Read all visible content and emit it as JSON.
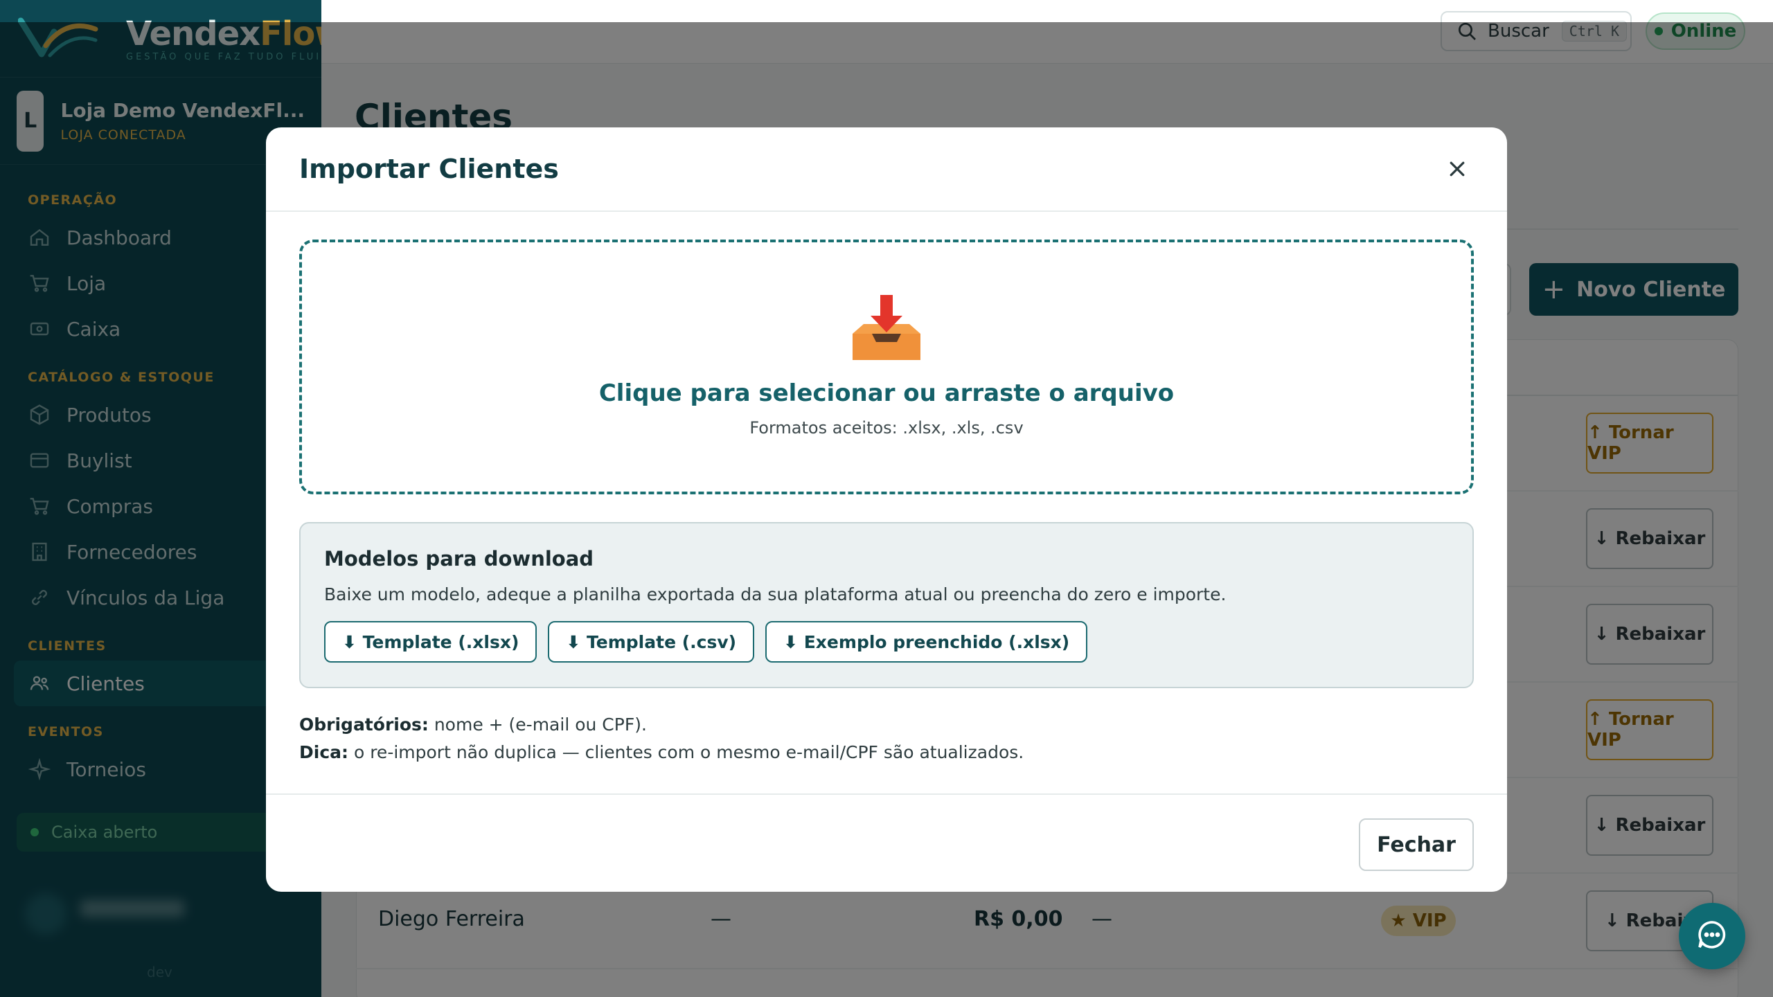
{
  "brand": {
    "name_part1": "Vendex",
    "name_part2": "Flow",
    "tagline": "GESTÃO QUE FAZ TUDO FLUIR"
  },
  "store": {
    "avatar_letter": "L",
    "name": "Loja Demo VendexFl...",
    "status": "LOJA CONECTADA"
  },
  "sidebar": {
    "sections": [
      {
        "title": "OPERAÇÃO",
        "items": [
          {
            "label": "Dashboard",
            "icon": "home-icon"
          },
          {
            "label": "Loja",
            "icon": "cart-icon"
          },
          {
            "label": "Caixa",
            "icon": "cash-icon"
          }
        ]
      },
      {
        "title": "CATÁLOGO & ESTOQUE",
        "items": [
          {
            "label": "Produtos",
            "icon": "box-icon"
          },
          {
            "label": "Buylist",
            "icon": "card-icon"
          },
          {
            "label": "Compras",
            "icon": "cart-icon"
          },
          {
            "label": "Fornecedores",
            "icon": "building-icon"
          },
          {
            "label": "Vínculos da Liga",
            "icon": "link-icon"
          }
        ]
      },
      {
        "title": "CLIENTES",
        "items": [
          {
            "label": "Clientes",
            "icon": "users-icon",
            "active": true
          }
        ]
      },
      {
        "title": "EVENTOS",
        "items": [
          {
            "label": "Torneios",
            "icon": "sparkle-icon"
          }
        ]
      }
    ],
    "cash_status": "Caixa aberto",
    "version": "dev"
  },
  "topbar": {
    "search_label": "Buscar",
    "search_shortcut": "Ctrl K",
    "status": "Online"
  },
  "page": {
    "title": "Clientes",
    "new_button": "Novo Cliente",
    "rows": [
      {
        "action": "↑ Tornar VIP",
        "kind": "vip"
      },
      {
        "action": "↓ Rebaixar",
        "kind": "down"
      },
      {
        "action": "↓ Rebaixar",
        "kind": "down"
      },
      {
        "action": "↑ Tornar VIP",
        "kind": "vip"
      },
      {
        "action": "↓ Rebaixar",
        "kind": "down"
      },
      {
        "action": "↓ Rebaix",
        "kind": "down"
      }
    ],
    "last_row": {
      "name": "Diego Ferreira",
      "col2": "—",
      "amount": "R$ 0,00",
      "col4": "—",
      "badge": "★ VIP"
    }
  },
  "modal": {
    "title": "Importar Clientes",
    "dropzone_title": "Clique para selecionar ou arraste o arquivo",
    "dropzone_sub": "Formatos aceitos: .xlsx, .xls, .csv",
    "models_title": "Modelos para download",
    "models_desc": "Baixe um modelo, adeque a planilha exportada da sua plataforma atual ou preencha do zero e importe.",
    "downloads": [
      "⬇ Template (.xlsx)",
      "⬇ Template (.csv)",
      "⬇ Exemplo preenchido (.xlsx)"
    ],
    "required_label": "Obrigatórios:",
    "required_text": " nome + (e-mail ou CPF).",
    "tip_label": "Dica:",
    "tip_text": " o re-import não duplica — clientes com o mesmo e-mail/CPF são atualizados.",
    "close_button": "Fechar"
  },
  "colors": {
    "sidebar_bg": "#0d4853",
    "accent": "#e7b64b",
    "primary": "#0e5560",
    "dropzone_border": "#1b7173"
  }
}
